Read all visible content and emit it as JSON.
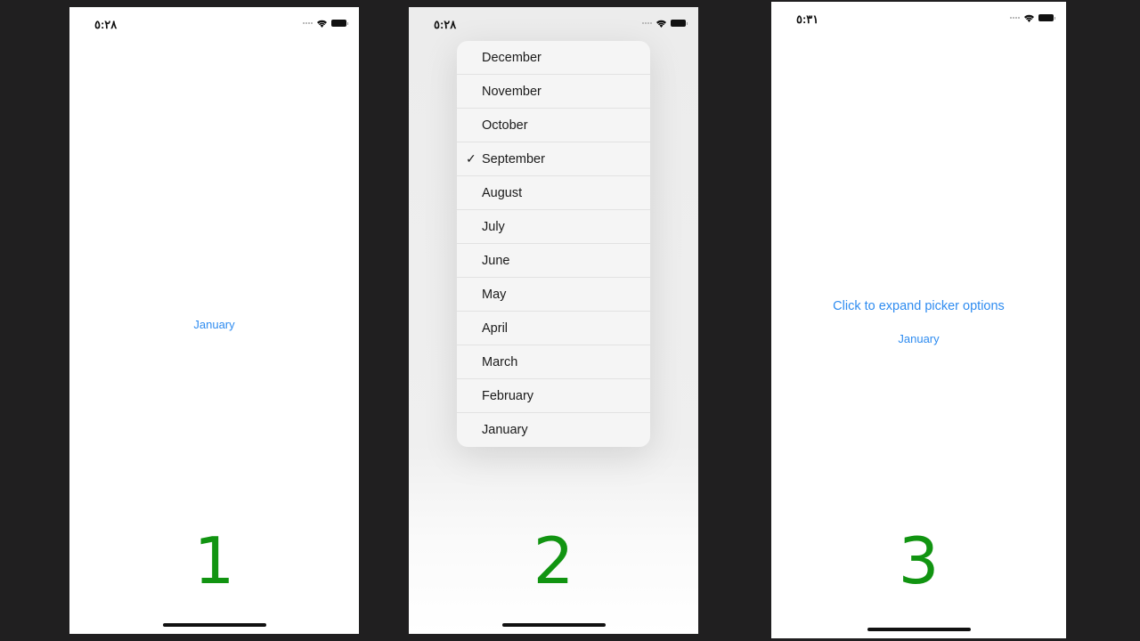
{
  "screens": [
    {
      "label": "1",
      "time": "٥:٢٨",
      "picker_value": "January"
    },
    {
      "label": "2",
      "time": "٥:٢٨",
      "menu_items": [
        "December",
        "November",
        "October",
        "September",
        "August",
        "July",
        "June",
        "May",
        "April",
        "March",
        "February",
        "January"
      ],
      "selected": "September",
      "check_glyph": "✓"
    },
    {
      "label": "3",
      "time": "٥:٣١",
      "prompt": "Click to expand picker options",
      "picker_value": "January"
    }
  ],
  "colors": {
    "accent": "#2f8cf0",
    "label_green": "#119411",
    "background": "#201f20"
  },
  "icons": [
    "wifi-icon",
    "battery-icon",
    "signal-icon",
    "checkmark-icon"
  ]
}
